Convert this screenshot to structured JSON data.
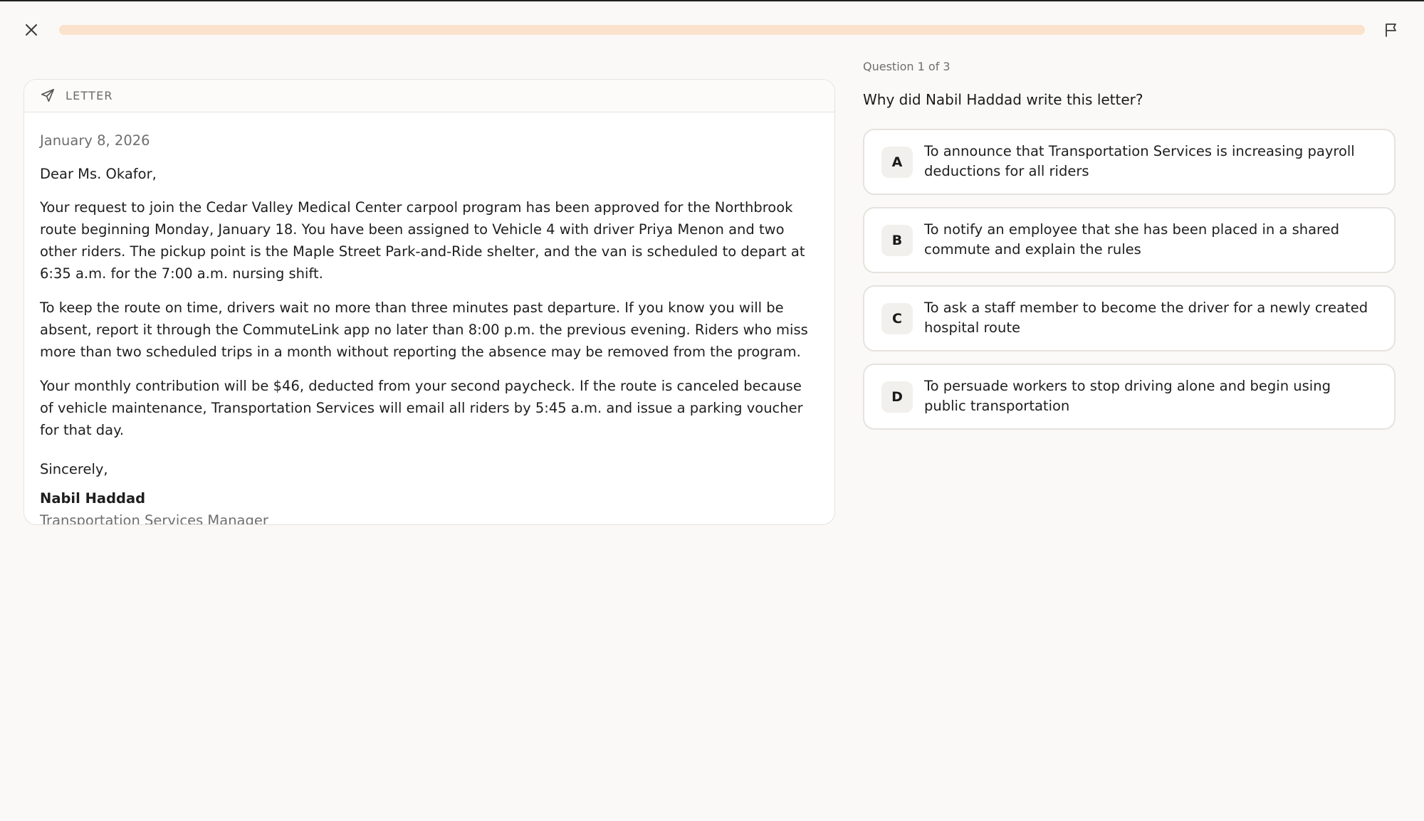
{
  "progress": {
    "fraction": 0.0
  },
  "icons": {
    "close": "close-icon",
    "flag": "flag-icon",
    "letter": "send-icon"
  },
  "colors": {
    "progress_track": "#fbe2cd",
    "progress_fill": "#f6b98d"
  },
  "letter": {
    "label": "LETTER",
    "date": "January 8, 2026",
    "greeting": "Dear Ms. Okafor,",
    "paragraphs": [
      "Your request to join the Cedar Valley Medical Center carpool program has been approved for the Northbrook route beginning Monday, January 18. You have been assigned to Vehicle 4 with driver Priya Menon and two other riders. The pickup point is the Maple Street Park-and-Ride shelter, and the van is scheduled to depart at 6:35 a.m. for the 7:00 a.m. nursing shift.",
      "To keep the route on time, drivers wait no more than three minutes past departure. If you know you will be absent, report it through the CommuteLink app no later than 8:00 p.m. the previous evening. Riders who miss more than two scheduled trips in a month without reporting the absence may be removed from the program.",
      "Your monthly contribution will be $46, deducted from your second paycheck. If the route is canceled because of vehicle maintenance, Transportation Services will email all riders by 5:45 a.m. and issue a parking voucher for that day."
    ],
    "closing": "Sincerely,",
    "signer_name": "Nabil Haddad",
    "signer_title": "Transportation Services Manager"
  },
  "question": {
    "counter": "Question 1 of 3",
    "text": "Why did Nabil Haddad write this letter?",
    "options": [
      {
        "letter": "A",
        "text": "To announce that Transportation Services is increasing payroll deductions for all riders"
      },
      {
        "letter": "B",
        "text": "To notify an employee that she has been placed in a shared commute and explain the rules"
      },
      {
        "letter": "C",
        "text": "To ask a staff member to become the driver for a newly created hospital route"
      },
      {
        "letter": "D",
        "text": "To persuade workers to stop driving alone and begin using public transportation"
      }
    ]
  }
}
